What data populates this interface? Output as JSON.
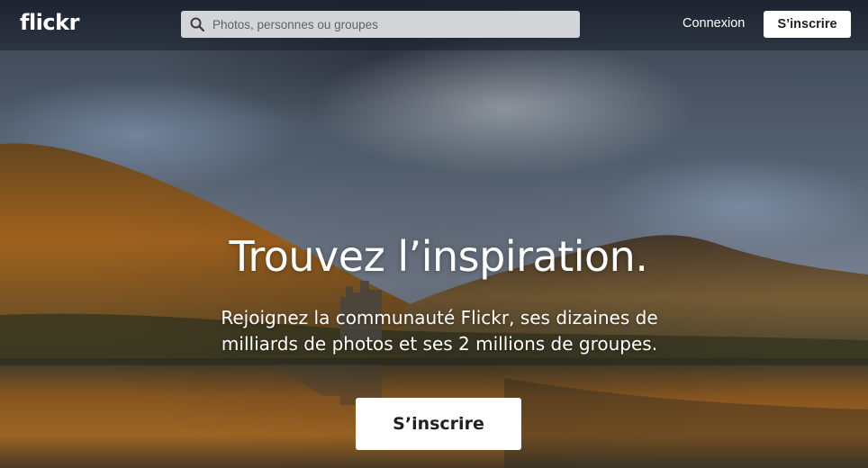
{
  "header": {
    "logo": "flickr",
    "search_placeholder": "Photos, personnes ou groupes",
    "login_label": "Connexion",
    "signup_label": "S’inscrire"
  },
  "hero": {
    "headline": "Trouvez l’inspiration.",
    "subtitle": "Rejoignez la communauté Flickr, ses dizaines de milliards de photos et ses 2 millions de groupes.",
    "cta_label": "S’inscrire"
  },
  "icons": {
    "search": "search-icon"
  },
  "colors": {
    "topbar": "#141a26",
    "search_bg": "#d4d5d8",
    "button_bg": "#ffffff",
    "button_text": "#212124"
  }
}
